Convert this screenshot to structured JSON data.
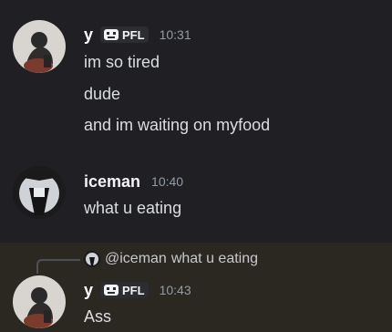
{
  "messages": [
    {
      "username": "y",
      "tag": "PFL",
      "timestamp": "10:31",
      "lines": [
        "im so tired",
        "dude",
        "and im waiting on myfood"
      ]
    },
    {
      "username": "iceman",
      "timestamp": "10:40",
      "lines": [
        "what u eating"
      ]
    },
    {
      "reply": {
        "mention": "@iceman",
        "text": "what u eating"
      },
      "username": "y",
      "tag": "PFL",
      "timestamp": "10:43",
      "lines": [
        "Ass"
      ]
    }
  ],
  "colors": {
    "background": "#1f1f24",
    "highlight": "#2b2822",
    "timestamp": "#949ba4",
    "text": "#dbdee1"
  },
  "icons": {
    "tag_icon": "guild-tag-icon",
    "avatar_y": "avatar-y",
    "avatar_iceman": "avatar-iceman"
  }
}
